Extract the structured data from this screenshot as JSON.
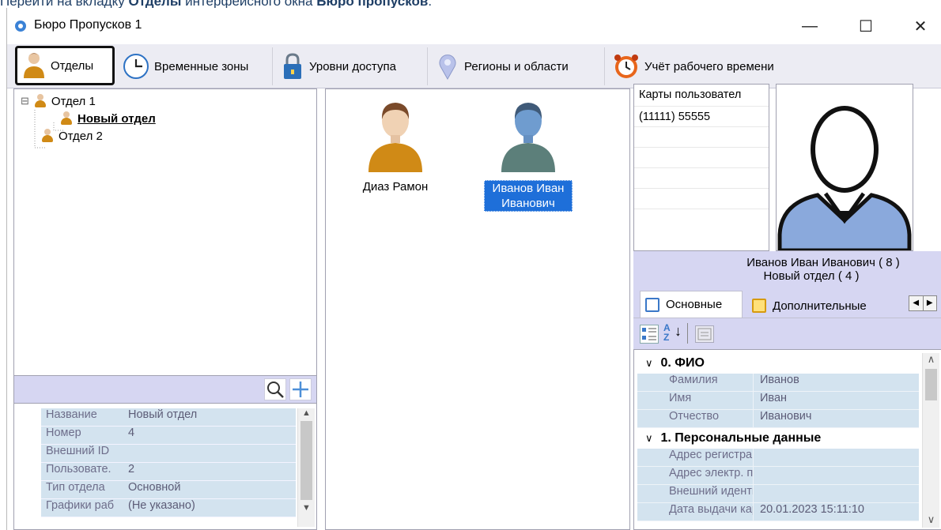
{
  "doc_caption": {
    "prefix": "Перейти на вкладку ",
    "tab": "Отделы",
    "middle": " интерфейсного окна ",
    "window": "Бюро пропусков",
    "suffix": "."
  },
  "window": {
    "title": "Бюро Пропусков 1",
    "controls": {
      "minimize": "—",
      "maximize": "☐",
      "close": "✕"
    }
  },
  "toolbar": {
    "tabs": [
      {
        "label": "Отделы",
        "icon": "person-icon"
      },
      {
        "label": "Временные зоны",
        "icon": "clock-icon"
      },
      {
        "label": "Уровни доступа",
        "icon": "lock-icon"
      },
      {
        "label": "Регионы и области",
        "icon": "map-pin-icon"
      },
      {
        "label": "Учёт рабочего времени",
        "icon": "alarm-clock-icon"
      }
    ]
  },
  "tree": {
    "nodes": [
      {
        "label": "Отдел 1",
        "toggle": "⊟"
      },
      {
        "label": "Новый отдел"
      },
      {
        "label": "Отдел 2"
      }
    ]
  },
  "dept_props": {
    "rows": [
      {
        "key": "Название",
        "value": "Новый отдел"
      },
      {
        "key": "Номер",
        "value": "4"
      },
      {
        "key": "Внешний ID",
        "value": ""
      },
      {
        "key": "Пользовате.",
        "value": "2"
      },
      {
        "key": "Тип отдела",
        "value": "Основной"
      },
      {
        "key": "Графики раб",
        "value": "(Не указано)"
      }
    ]
  },
  "users": [
    {
      "name": "Диаз Рамон",
      "selected": false
    },
    {
      "name_line1": "Иванов Иван",
      "name_line2": "Иванович",
      "selected": true
    }
  ],
  "cards": {
    "header": "Карты пользовател",
    "items": [
      "(11111) 55555"
    ]
  },
  "user_info": {
    "line1": "Иванов Иван Иванович ( 8 )",
    "line2": "Новый отдел ( 4 )"
  },
  "tabs": {
    "main": "Основные",
    "extra": "Дополнительные"
  },
  "property_grid": {
    "categories": [
      {
        "title": "0. ФИО",
        "rows": [
          {
            "key": "Фамилия",
            "value": "Иванов"
          },
          {
            "key": "Имя",
            "value": "Иван"
          },
          {
            "key": "Отчество",
            "value": "Иванович"
          }
        ]
      },
      {
        "title": "1. Персональные данные",
        "rows": [
          {
            "key": "Адрес регистрац",
            "value": ""
          },
          {
            "key": "Адрес электр. по",
            "value": ""
          },
          {
            "key": "Внешний идентис",
            "value": ""
          },
          {
            "key": "Дата выдачи кар",
            "value": "20.01.2023 15:11:10"
          }
        ]
      }
    ]
  },
  "colors": {
    "selection": "#1e6fd9",
    "orange_person": "#d08a16",
    "blue_person": "#5f86a8",
    "lavender": "#d6d6f2"
  }
}
